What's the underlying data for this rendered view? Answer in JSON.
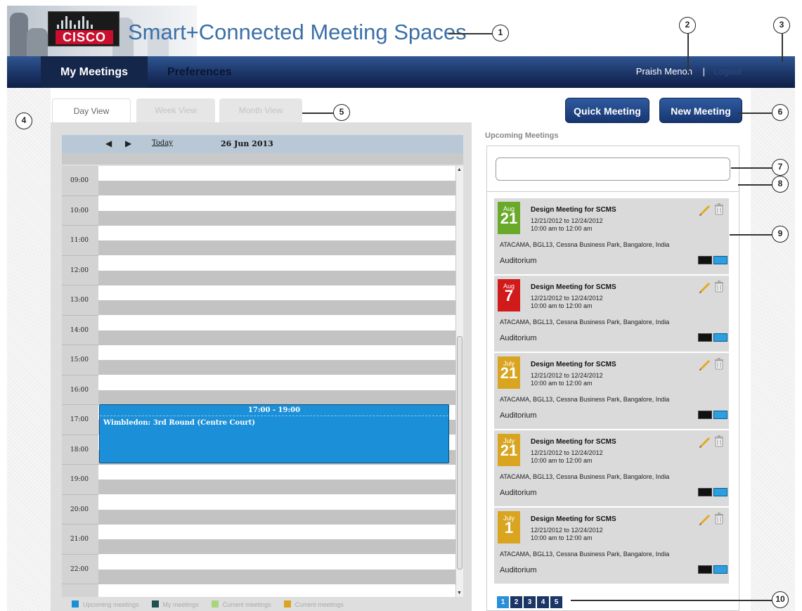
{
  "header": {
    "app_title": "Smart+Connected Meeting Spaces",
    "logo_text": "CISCO"
  },
  "callouts": [
    "1",
    "2",
    "3",
    "4",
    "5",
    "6",
    "7",
    "8",
    "9",
    "10"
  ],
  "nav": {
    "tabs": [
      {
        "label": "My Meetings",
        "active": true
      },
      {
        "label": "Preferences",
        "active": false
      }
    ],
    "user_name": "Praish Menon",
    "separator": "|",
    "logout": "Logout"
  },
  "view_tabs": [
    "Day View",
    "Week View",
    "Month View"
  ],
  "calendar": {
    "prev_icon": "triangle-left",
    "next_icon": "triangle-right",
    "today": "Today",
    "date": "26 Jun 2013",
    "hours": [
      "09:00",
      "10:00",
      "11:00",
      "12:00",
      "13:00",
      "14:00",
      "15:00",
      "16:00",
      "17:00",
      "18:00",
      "19:00",
      "20:00",
      "21:00",
      "22:00"
    ],
    "event": {
      "time": "17:00 - 19:00",
      "title": "Wimbledon: 3rd Round (Centre Court)",
      "color": "#1b8fd8"
    }
  },
  "legend": [
    {
      "label": "Upcoming meetings",
      "color": "#1b8fd8"
    },
    {
      "label": "My meetings",
      "color": "#1f4f4f"
    },
    {
      "label": "Current meetings",
      "color": "#a8d67a"
    },
    {
      "label": "Current meetings",
      "color": "#d9a521"
    }
  ],
  "buttons": {
    "quick": "Quick Meeting",
    "new": "New Meeting"
  },
  "upcoming": {
    "label": "Upcoming Meetings",
    "search_value": "",
    "meetings": [
      {
        "month": "Aug",
        "day": "21",
        "color": "#6aaa2a",
        "title": "Design Meeting for SCMS",
        "dates": "12/21/2012 to 12/24/2012",
        "time": "10:00 am to 12:00 am",
        "location": "ATACAMA, BGL13, Cessna Business Park, Bangalore, India",
        "room": "Auditorium"
      },
      {
        "month": "Aug",
        "day": "7",
        "color": "#d11a1a",
        "title": "Design Meeting for SCMS",
        "dates": "12/21/2012 to 12/24/2012",
        "time": "10:00 am to 12:00 am",
        "location": "ATACAMA, BGL13, Cessna Business Park, Bangalore, India",
        "room": "Auditorium"
      },
      {
        "month": "July",
        "day": "21",
        "color": "#d9a521",
        "title": "Design Meeting for SCMS",
        "dates": "12/21/2012 to 12/24/2012",
        "time": "10:00 am to 12:00 am",
        "location": "ATACAMA, BGL13, Cessna Business Park, Bangalore, India",
        "room": "Auditorium"
      },
      {
        "month": "July",
        "day": "21",
        "color": "#d9a521",
        "title": "Design Meeting for SCMS",
        "dates": "12/21/2012 to 12/24/2012",
        "time": "10:00 am to 12:00 am",
        "location": "ATACAMA, BGL13, Cessna Business Park, Bangalore, India",
        "room": "Auditorium"
      },
      {
        "month": "July",
        "day": "1",
        "color": "#d9a521",
        "title": "Design Meeting for SCMS",
        "dates": "12/21/2012 to 12/24/2012",
        "time": "10:00 am to 12:00 am",
        "location": "ATACAMA, BGL13, Cessna Business Park, Bangalore, India",
        "room": "Auditorium"
      }
    ],
    "pages": [
      "1",
      "2",
      "3",
      "4",
      "5"
    ],
    "active_page": "1"
  }
}
